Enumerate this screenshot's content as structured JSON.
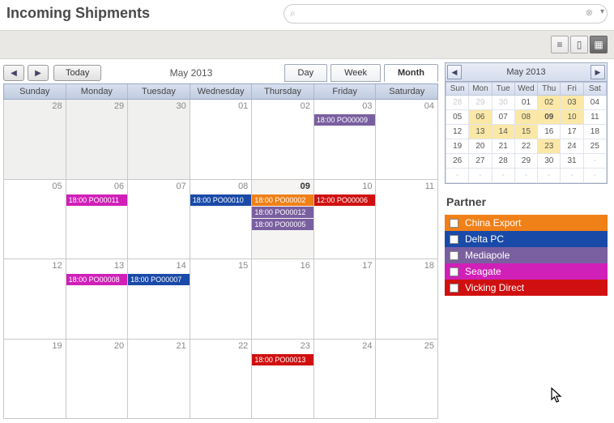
{
  "title": "Incoming Shipments",
  "search": {
    "placeholder": ""
  },
  "toolbar": {
    "list_icon": "≡",
    "kanban_icon": "▯",
    "calendar_icon": "▦"
  },
  "main_calendar": {
    "period_label": "May 2013",
    "today_label": "Today",
    "views": {
      "day": "Day",
      "week": "Week",
      "month": "Month"
    },
    "day_headers": [
      "Sunday",
      "Monday",
      "Tuesday",
      "Wednesday",
      "Thursday",
      "Friday",
      "Saturday"
    ],
    "grid": [
      [
        {
          "num": "28",
          "other": true,
          "events": []
        },
        {
          "num": "29",
          "other": true,
          "events": []
        },
        {
          "num": "30",
          "other": true,
          "events": []
        },
        {
          "num": "01",
          "events": []
        },
        {
          "num": "02",
          "events": []
        },
        {
          "num": "03",
          "events": [
            {
              "label": "18:00 PO00009",
              "color": "#7a5fa0"
            }
          ]
        },
        {
          "num": "04",
          "events": []
        }
      ],
      [
        {
          "num": "05",
          "events": []
        },
        {
          "num": "06",
          "events": [
            {
              "label": "18:00 PO00011",
              "color": "#d020b8"
            }
          ]
        },
        {
          "num": "07",
          "events": []
        },
        {
          "num": "08",
          "events": [
            {
              "label": "18:00 PO00010",
              "color": "#1a4aa8"
            }
          ]
        },
        {
          "num": "09",
          "today": true,
          "events": [
            {
              "label": "18:00 PO00002",
              "color": "#f08018"
            },
            {
              "label": "18:00 PO00012",
              "color": "#7a5fa0"
            },
            {
              "label": "18:00 PO00005",
              "color": "#7a5fa0"
            }
          ]
        },
        {
          "num": "10",
          "events": [
            {
              "label": "12:00 PO00006",
              "color": "#d01010"
            }
          ]
        },
        {
          "num": "11",
          "events": []
        }
      ],
      [
        {
          "num": "12",
          "events": []
        },
        {
          "num": "13",
          "events": [
            {
              "label": "18:00 PO00008",
              "color": "#d020b8"
            }
          ]
        },
        {
          "num": "14",
          "events": [
            {
              "label": "18:00 PO00007",
              "color": "#1a4aa8"
            }
          ]
        },
        {
          "num": "15",
          "events": []
        },
        {
          "num": "16",
          "events": []
        },
        {
          "num": "17",
          "events": []
        },
        {
          "num": "18",
          "events": []
        }
      ],
      [
        {
          "num": "19",
          "events": []
        },
        {
          "num": "20",
          "events": []
        },
        {
          "num": "21",
          "events": []
        },
        {
          "num": "22",
          "events": []
        },
        {
          "num": "23",
          "events": [
            {
              "label": "18:00 PO00013",
              "color": "#d01010"
            }
          ]
        },
        {
          "num": "24",
          "events": []
        },
        {
          "num": "25",
          "events": []
        }
      ]
    ]
  },
  "mini_calendar": {
    "title": "May 2013",
    "day_headers": [
      "Sun",
      "Mon",
      "Tue",
      "Wed",
      "Thu",
      "Fri",
      "Sat"
    ],
    "rows": [
      [
        {
          "n": "28",
          "o": true
        },
        {
          "n": "29",
          "o": true
        },
        {
          "n": "30",
          "o": true
        },
        {
          "n": "01"
        },
        {
          "n": "02",
          "h": true
        },
        {
          "n": "03",
          "h": true
        },
        {
          "n": "04"
        }
      ],
      [
        {
          "n": "05"
        },
        {
          "n": "06",
          "h": true
        },
        {
          "n": "07"
        },
        {
          "n": "08",
          "h": true
        },
        {
          "n": "09",
          "h": true,
          "t": true
        },
        {
          "n": "10",
          "h": true
        },
        {
          "n": "11"
        }
      ],
      [
        {
          "n": "12"
        },
        {
          "n": "13",
          "h": true
        },
        {
          "n": "14",
          "h": true
        },
        {
          "n": "15",
          "h": true
        },
        {
          "n": "16"
        },
        {
          "n": "17"
        },
        {
          "n": "18"
        }
      ],
      [
        {
          "n": "19"
        },
        {
          "n": "20"
        },
        {
          "n": "21"
        },
        {
          "n": "22"
        },
        {
          "n": "23",
          "h": true
        },
        {
          "n": "24"
        },
        {
          "n": "25"
        }
      ],
      [
        {
          "n": "26"
        },
        {
          "n": "27"
        },
        {
          "n": "28"
        },
        {
          "n": "29"
        },
        {
          "n": "30"
        },
        {
          "n": "31"
        },
        {
          "n": "-",
          "o": true
        }
      ],
      [
        {
          "n": "-",
          "o": true
        },
        {
          "n": "-",
          "o": true
        },
        {
          "n": "-",
          "o": true
        },
        {
          "n": "-",
          "o": true
        },
        {
          "n": "-",
          "o": true
        },
        {
          "n": "-",
          "o": true
        },
        {
          "n": "-",
          "o": true
        }
      ]
    ]
  },
  "partner": {
    "title": "Partner",
    "items": [
      {
        "name": "China Export",
        "color": "#f08018"
      },
      {
        "name": "Delta PC",
        "color": "#1a4aa8"
      },
      {
        "name": "Mediapole",
        "color": "#7a5fa0"
      },
      {
        "name": "Seagate",
        "color": "#d020b8"
      },
      {
        "name": "Vicking Direct",
        "color": "#d01010"
      }
    ]
  }
}
